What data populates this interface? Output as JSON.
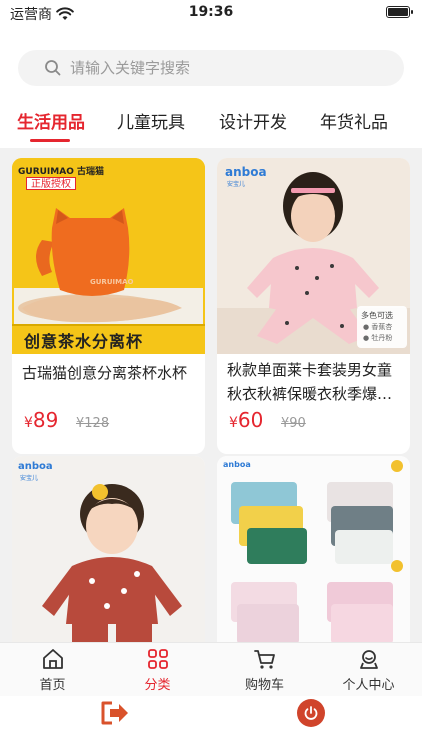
{
  "status": {
    "carrier": "运营商",
    "time": "19:36"
  },
  "search": {
    "placeholder": "请输入关键字搜索"
  },
  "tabs": [
    {
      "label": "生活用品",
      "active": true
    },
    {
      "label": "儿童玩具",
      "active": false
    },
    {
      "label": "设计开发",
      "active": false
    },
    {
      "label": "年货礼品",
      "active": false
    }
  ],
  "products": [
    {
      "title": "古瑞猫创意分离茶杯水杯",
      "price_symbol": "¥",
      "price": "89",
      "original_price": "¥128",
      "image_brand": "GURUIMAO 古瑞猫",
      "image_tag": "正版授权",
      "image_caption": "创意茶水分离杯",
      "image_mug_text": "GURUIMAO"
    },
    {
      "title": "秋款单面莱卡套装男女童秋衣秋裤保暖衣秋季爆…",
      "price_symbol": "¥",
      "price": "60",
      "original_price": "¥90",
      "image_brand": "anboa",
      "image_brand_cn": "安宝儿",
      "image_badge_title": "多色可选",
      "image_badge_1": "● 香蕉杏",
      "image_badge_2": "● 牡丹粉"
    },
    {
      "image_brand": "anboa",
      "image_brand_cn": "安宝儿"
    },
    {
      "image_brand": "anboa"
    }
  ],
  "tabbar": [
    {
      "label": "首页",
      "icon": "home-icon",
      "active": false
    },
    {
      "label": "分类",
      "icon": "category-icon",
      "active": true
    },
    {
      "label": "购物车",
      "icon": "cart-icon",
      "active": false
    },
    {
      "label": "个人中心",
      "icon": "profile-icon",
      "active": false
    }
  ],
  "colors": {
    "accent": "#e5262f",
    "power": "#d0442b",
    "exit": "#d9522b"
  }
}
